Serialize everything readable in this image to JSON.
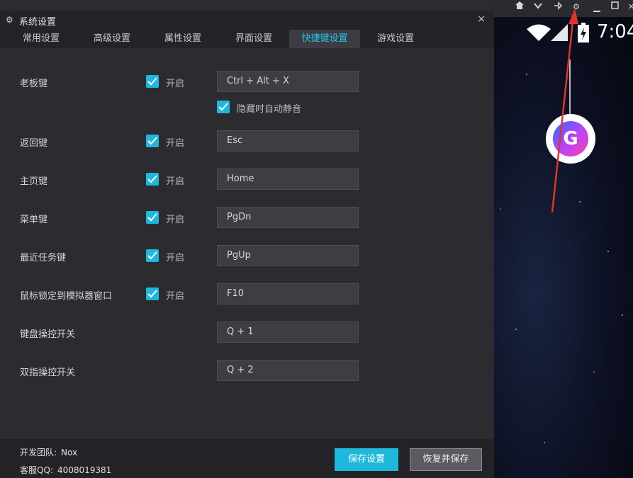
{
  "dialog": {
    "title": "系统设置",
    "close_label": "×",
    "tabs": [
      {
        "label": "常用设置"
      },
      {
        "label": "高级设置"
      },
      {
        "label": "属性设置"
      },
      {
        "label": "界面设置"
      },
      {
        "label": "快捷键设置",
        "active": true
      },
      {
        "label": "游戏设置"
      }
    ]
  },
  "shortcuts": {
    "enable_label": "开启",
    "boss_key": {
      "label": "老板键",
      "enabled": true,
      "value": "Ctrl + Alt + X",
      "mute_label": "隐藏时自动静音",
      "mute_enabled": true
    },
    "back_key": {
      "label": "返回键",
      "enabled": true,
      "value": "Esc"
    },
    "home_key": {
      "label": "主页键",
      "enabled": true,
      "value": "Home"
    },
    "menu_key": {
      "label": "菜单键",
      "enabled": true,
      "value": "PgDn"
    },
    "recent_key": {
      "label": "最近任务键",
      "enabled": true,
      "value": "PgUp"
    },
    "mouse_lock_key": {
      "label": "鼠标锁定到模拟器窗口",
      "enabled": true,
      "value": "F10"
    },
    "keyboard_toggle": {
      "label": "键盘操控开关",
      "value": "Q + 1"
    },
    "two_finger_toggle": {
      "label": "双指操控开关",
      "value": "Q + 2"
    }
  },
  "footer": {
    "team_label": "开发团队:",
    "team_value": "Nox",
    "qq_label": "客服QQ:",
    "qq_value": "4008019381",
    "save_button": "保存设置",
    "restore_button": "恢复并保存"
  },
  "emulator": {
    "clock": "7:04",
    "window_buttons": [
      "home-icon",
      "chevron-down-icon",
      "pin-icon",
      "gear-icon",
      "minimize-icon",
      "maximize-icon",
      "close-icon"
    ],
    "app_icon_letter": "G"
  },
  "colors": {
    "accent": "#1eb8dc",
    "active_tab_text": "#26c6e5",
    "background": "#2b2b30",
    "arrow": "#e0332b"
  }
}
